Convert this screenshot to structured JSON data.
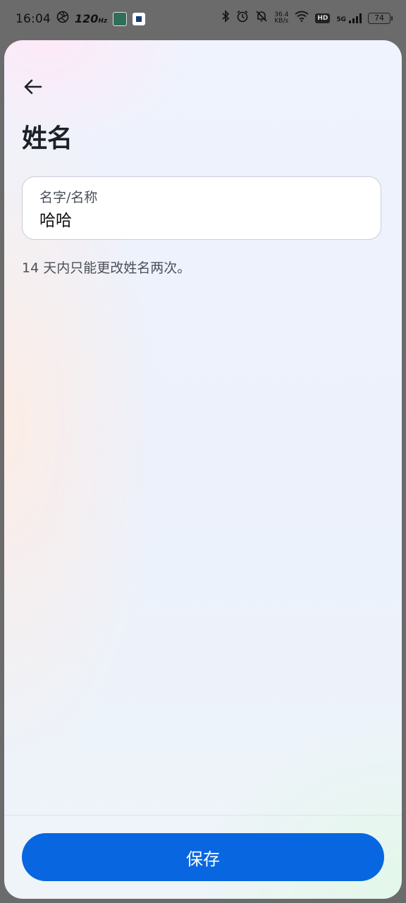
{
  "status_bar": {
    "time": "16:04",
    "refresh_rate": "120",
    "refresh_unit": "Hz",
    "net_speed_value": "36.4",
    "net_speed_unit": "KB/s",
    "hd_label": "HD",
    "network_label": "5G",
    "battery_level": "74"
  },
  "header": {
    "title": "姓名"
  },
  "name_field": {
    "label": "名字/名称",
    "value": "哈哈"
  },
  "hint": "14 天内只能更改姓名两次。",
  "footer": {
    "save_label": "保存"
  },
  "colors": {
    "primary": "#0866e0",
    "title_text": "#1c2126",
    "secondary_text": "#4a5058"
  },
  "icons": {
    "back": "back-arrow-icon"
  }
}
